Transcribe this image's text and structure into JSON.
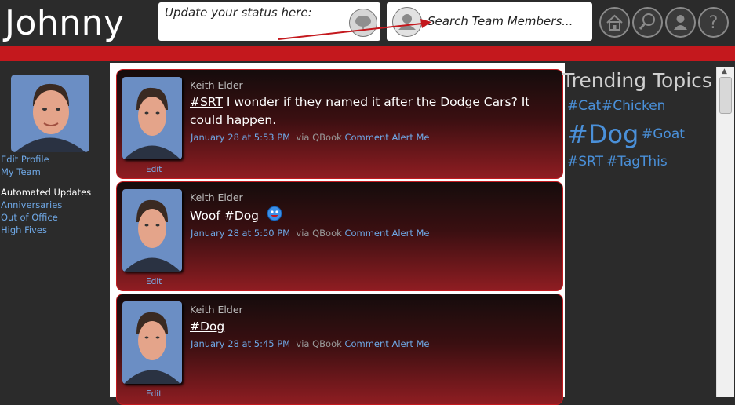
{
  "header": {
    "title": "Johnny",
    "status_placeholder": "Update your status here:",
    "search_placeholder": "Search Team Members..."
  },
  "sidebar": {
    "links": [
      "Edit Profile",
      "My Team"
    ],
    "section_title": "Automated Updates",
    "updates": [
      "Anniversaries",
      "Out of Office",
      "High Fives"
    ]
  },
  "posts": [
    {
      "author": "Keith Elder",
      "tag": "#SRT",
      "text": " I wonder if they named it after the Dodge Cars? It could happen.",
      "date": "January 28 at 5:53 PM",
      "via": "via QBook",
      "comment": "Comment",
      "alert": "Alert Me",
      "edit": "Edit"
    },
    {
      "author": "Keith Elder",
      "prefix": "Woof ",
      "tag": "#Dog",
      "date": "January 28 at 5:50 PM",
      "via": "via QBook",
      "comment": "Comment",
      "alert": "Alert Me",
      "edit": "Edit"
    },
    {
      "author": "Keith Elder",
      "tag": "#Dog",
      "date": "January 28 at 5:45 PM",
      "via": "via QBook",
      "comment": "Comment",
      "alert": "Alert Me",
      "edit": "Edit"
    }
  ],
  "trending": {
    "title": "Trending Topics",
    "topics": [
      "#Cat",
      "#Chicken",
      "#Dog",
      "#Goat",
      "#SRT",
      "#TagThis"
    ]
  },
  "colors": {
    "header_bg": "#2b2b2b",
    "accent_red": "#c4181d",
    "link_blue": "#6fa8e6",
    "trend_blue": "#4a90d9"
  }
}
